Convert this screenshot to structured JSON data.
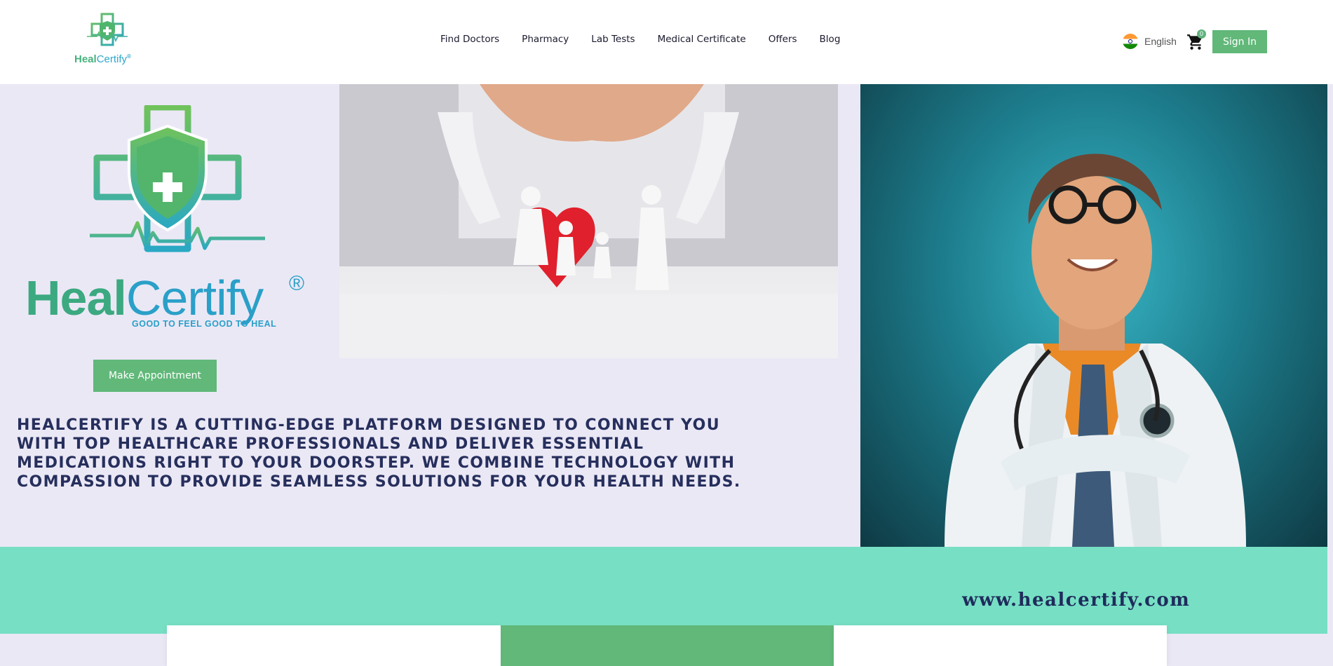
{
  "header": {
    "brand": {
      "heal": "Heal",
      "certify": "Certify",
      "reg": "®"
    },
    "nav": [
      "Find Doctors",
      "Pharmacy",
      "Lab Tests",
      "Medical Certificate",
      "Offers",
      "Blog"
    ],
    "language": "English",
    "cart_count": "0",
    "signin_label": "Sign In"
  },
  "hero": {
    "logo": {
      "heal": "Heal",
      "certify": "Certify",
      "reg": "®",
      "tagline": "GOOD TO FEEL   GOOD TO HEAL"
    },
    "appointment_label": "Make Appointment",
    "mission": "HEALCERTIFY IS A CUTTING-EDGE PLATFORM DESIGNED TO CONNECT YOU WITH TOP HEALTHCARE PROFESSIONALS AND DELIVER ESSENTIAL MEDICATIONS RIGHT TO YOUR DOORSTEP. WE COMBINE TECHNOLOGY WITH COMPASSION TO PROVIDE SEAMLESS SOLUTIONS FOR YOUR HEALTH NEEDS."
  },
  "band": {
    "url": "www.healcertify.com"
  },
  "colors": {
    "accent": "#61b879",
    "teal_band": "#77dfc4",
    "navy": "#262f5c",
    "lavender": "#ebe8f6"
  },
  "icons": [
    "brand-logo-icon",
    "india-flag-icon",
    "cart-icon",
    "hero-logo-icon"
  ]
}
